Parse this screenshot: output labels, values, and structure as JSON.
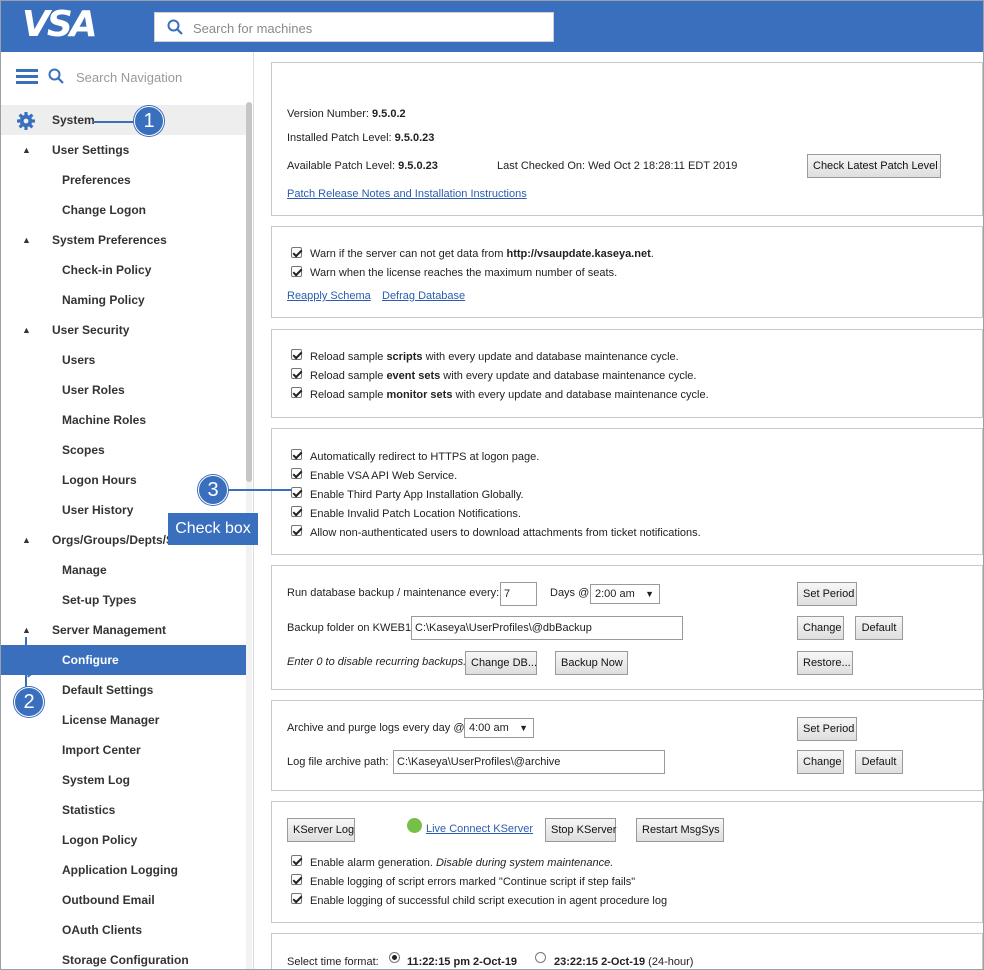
{
  "header": {
    "logo": "VSA",
    "search_placeholder": "Search for machines"
  },
  "sidebar": {
    "search_placeholder": "Search Navigation",
    "items": [
      {
        "label": "System",
        "level": 0
      },
      {
        "label": "User Settings",
        "level": 1
      },
      {
        "label": "Preferences",
        "level": 2
      },
      {
        "label": "Change Logon",
        "level": 2
      },
      {
        "label": "System Preferences",
        "level": 1
      },
      {
        "label": "Check-in Policy",
        "level": 2
      },
      {
        "label": "Naming Policy",
        "level": 2
      },
      {
        "label": "User Security",
        "level": 1
      },
      {
        "label": "Users",
        "level": 2
      },
      {
        "label": "User Roles",
        "level": 2
      },
      {
        "label": "Machine Roles",
        "level": 2
      },
      {
        "label": "Scopes",
        "level": 2
      },
      {
        "label": "Logon Hours",
        "level": 2
      },
      {
        "label": "User History",
        "level": 2
      },
      {
        "label": "Orgs/Groups/Depts/Staff",
        "level": 1
      },
      {
        "label": "Manage",
        "level": 2
      },
      {
        "label": "Set-up Types",
        "level": 2
      },
      {
        "label": "Server Management",
        "level": 1
      },
      {
        "label": "Configure",
        "level": 2,
        "active": true
      },
      {
        "label": "Default Settings",
        "level": 2
      },
      {
        "label": "License Manager",
        "level": 2
      },
      {
        "label": "Import Center",
        "level": 2
      },
      {
        "label": "System Log",
        "level": 2
      },
      {
        "label": "Statistics",
        "level": 2
      },
      {
        "label": "Logon Policy",
        "level": 2
      },
      {
        "label": "Application Logging",
        "level": 2
      },
      {
        "label": "Outbound Email",
        "level": 2
      },
      {
        "label": "OAuth Clients",
        "level": 2
      },
      {
        "label": "Storage Configuration",
        "level": 2
      }
    ]
  },
  "annotations": {
    "callout1": "1",
    "callout2": "2",
    "callout3": "3",
    "tooltip": "Check box"
  },
  "version_panel": {
    "version_label": "Version Number:",
    "version_value": "9.5.0.2",
    "installed_label": "Installed Patch Level:",
    "installed_value": "9.5.0.23",
    "available_label": "Available Patch Level:",
    "available_value": "9.5.0.23",
    "last_checked": "Last Checked On: Wed Oct 2 18:28:11 EDT 2019",
    "check_button": "Check Latest Patch Level",
    "release_notes_link": "Patch Release Notes and Installation Instructions"
  },
  "warn_panel": {
    "warn1_prefix": "Warn if the server can not get data from ",
    "warn1_bold": "http://vsaupdate.kaseya.net",
    "warn1_suffix": ".",
    "warn2": "Warn when the license reaches the maximum number of seats.",
    "reapply_link": "Reapply Schema",
    "defrag_link": "Defrag Database"
  },
  "reload_panel": {
    "prefix": "Reload sample ",
    "item1_bold": "scripts",
    "item1_suffix": " with every update and database maintenance cycle.",
    "item2_bold": "event sets",
    "item2_suffix": " with every update and database maintenance cycle.",
    "item3_bold": "monitor sets",
    "item3_suffix": " with every update and database maintenance cycle."
  },
  "options_panel": {
    "opt1": "Automatically redirect to HTTPS at logon page.",
    "opt2": "Enable VSA API Web Service.",
    "opt3": "Enable Third Party App Installation Globally.",
    "opt4": "Enable Invalid Patch Location Notifications.",
    "opt5": "Allow non-authenticated users to download attachments from ticket notifications."
  },
  "backup_panel": {
    "run_label": "Run database backup / maintenance every:",
    "days_value": "7",
    "days_label": "Days @",
    "time_value": "2:00 am",
    "set_period": "Set Period",
    "folder_label": "Backup folder on KWEB1",
    "folder_value": "C:\\Kaseya\\UserProfiles\\@dbBackup",
    "change": "Change",
    "default": "Default",
    "hint": "Enter 0 to disable recurring backups.",
    "change_db": "Change DB...",
    "backup_now": "Backup Now",
    "restore": "Restore..."
  },
  "archive_panel": {
    "archive_label": "Archive and purge logs every day @",
    "time_value": "4:00 am",
    "set_period": "Set Period",
    "path_label": "Log file archive path:",
    "path_value": "C:\\Kaseya\\UserProfiles\\@archive",
    "change": "Change",
    "default": "Default"
  },
  "kserver_panel": {
    "kserver_log": "KServer Log",
    "live_connect": "Live Connect KServer",
    "stop": "Stop KServer",
    "restart": "Restart MsgSys",
    "alarm_label": "Enable alarm generation.",
    "alarm_note": "Disable during system maintenance.",
    "script_errors": "Enable logging of script errors marked \"Continue script if step fails\"",
    "child_script": "Enable logging of successful child script execution in agent procedure log"
  },
  "time_panel": {
    "label": "Select time format:",
    "opt1": "11:22:15 pm 2-Oct-19",
    "opt2": "23:22:15 2-Oct-19",
    "opt2_suffix": "(24-hour)"
  }
}
